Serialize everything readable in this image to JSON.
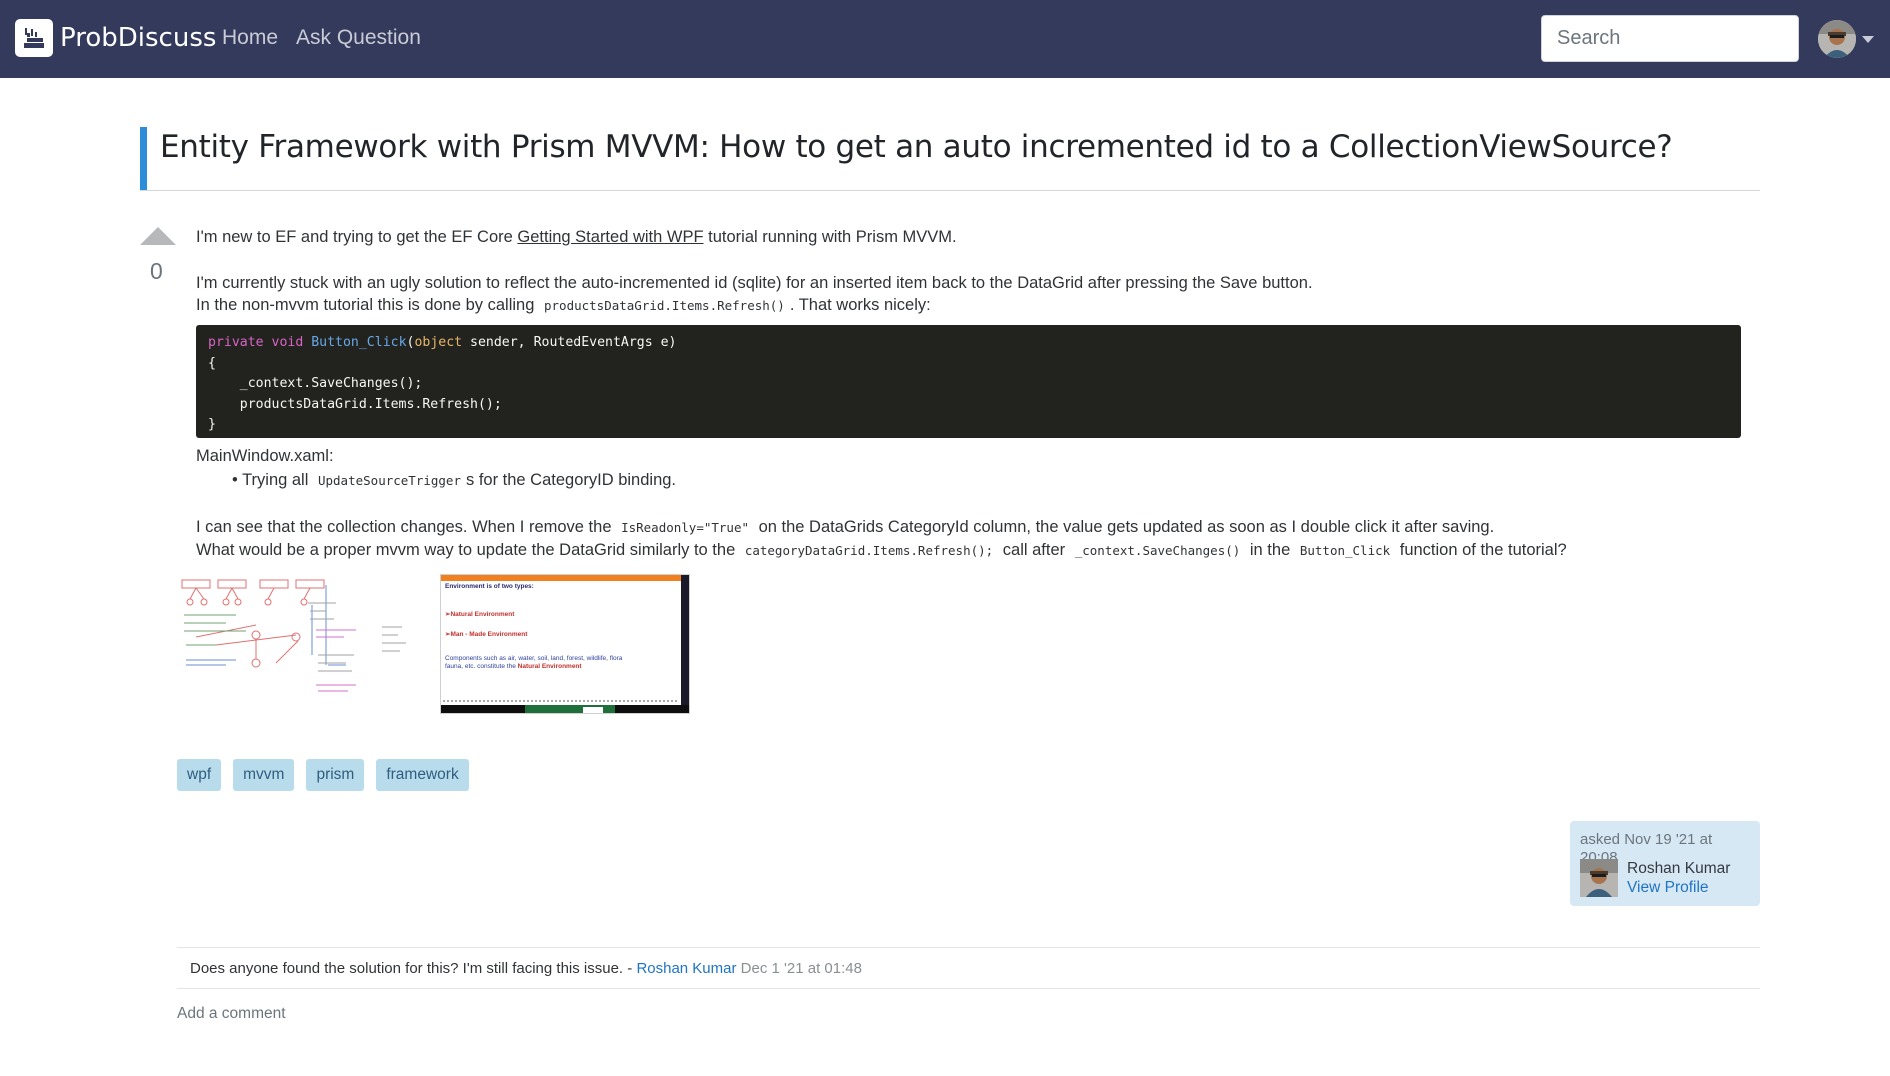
{
  "navbar": {
    "brand": "ProbDiscuss",
    "links": [
      {
        "label": "Home"
      },
      {
        "label": "Ask Question"
      }
    ],
    "search": {
      "placeholder": "Search",
      "value": ""
    }
  },
  "question": {
    "title": "Entity Framework with Prism MVVM: How to get an auto incremented id to a CollectionViewSource?",
    "votes": "0",
    "body": {
      "p1_pre": "I'm new to EF and trying to get the EF Core ",
      "p1_link": "Getting Started with WPF",
      "p1_post": " tutorial running with Prism MVVM.",
      "p2": "I'm currently stuck with an ugly solution to reflect the auto-incremented id (sqlite) for an inserted item back to the DataGrid after pressing the Save button.",
      "p3_pre": "In the non-mvvm tutorial this is done by calling ",
      "p3_code": "productsDataGrid.Items.Refresh()",
      "p3_post": ". That works nicely:",
      "code": {
        "l1_kw": "private void",
        "l1_fn": "Button_Click",
        "l1_p1": "(",
        "l1_ty": "object",
        "l1_p2": " sender, RoutedEventArgs e)",
        "l2": "{",
        "l3": "    _context.SaveChanges();",
        "l4": "    productsDataGrid.Items.Refresh();",
        "l5": "}"
      },
      "p4": "MainWindow.xaml:",
      "bullet_pre": "• Trying all ",
      "bullet_code": "UpdateSourceTrigger",
      "bullet_post": "s for the CategoryID binding.",
      "p5_pre": "I can see that the collection changes. When I remove the ",
      "p5_code": "IsReadonly=\"True\"",
      "p5_post": " on the DataGrids CategoryId column, the value gets updated as soon as I double click it after saving.",
      "p6_pre": "What would be a proper mvvm way to update the DataGrid similarly to the ",
      "p6_code1": "categoryDataGrid.Items.Refresh();",
      "p6_mid1": " call after ",
      "p6_code2": "_context.SaveChanges()",
      "p6_mid2": " in the ",
      "p6_code3": "Button_Click",
      "p6_post": " function of the tutorial?"
    },
    "images": {
      "slide_heading": "Environment is of two types:",
      "slide_item1": "➢Natural Environment",
      "slide_item2": "➢Man - Made Environment",
      "slide_text1": "Components such as air, water, soil, land, forest, wildlife, flora",
      "slide_text2_pre": "fauna, etc. constitute the ",
      "slide_text2_hl": "Natural Environment"
    },
    "tags": [
      "wpf",
      "mvvm",
      "prism",
      "framework"
    ],
    "asked": {
      "time": "asked Nov 19 '21 at 20:08",
      "user": "Roshan Kumar",
      "profile_link": "View Profile"
    }
  },
  "comments": [
    {
      "text": "Does anyone found the solution for this? I'm still facing this issue. - ",
      "author": "Roshan Kumar",
      "time": "Dec 1 '21 at 01:48"
    }
  ],
  "add_comment": "Add a comment",
  "colors": {
    "navbar_bg": "#343a5c",
    "title_accent": "#2e8dd8",
    "tag_bg": "#b9dcec",
    "asked_bg": "#d7e8f5",
    "link": "#1f74c4",
    "code_bg": "#22221e"
  }
}
